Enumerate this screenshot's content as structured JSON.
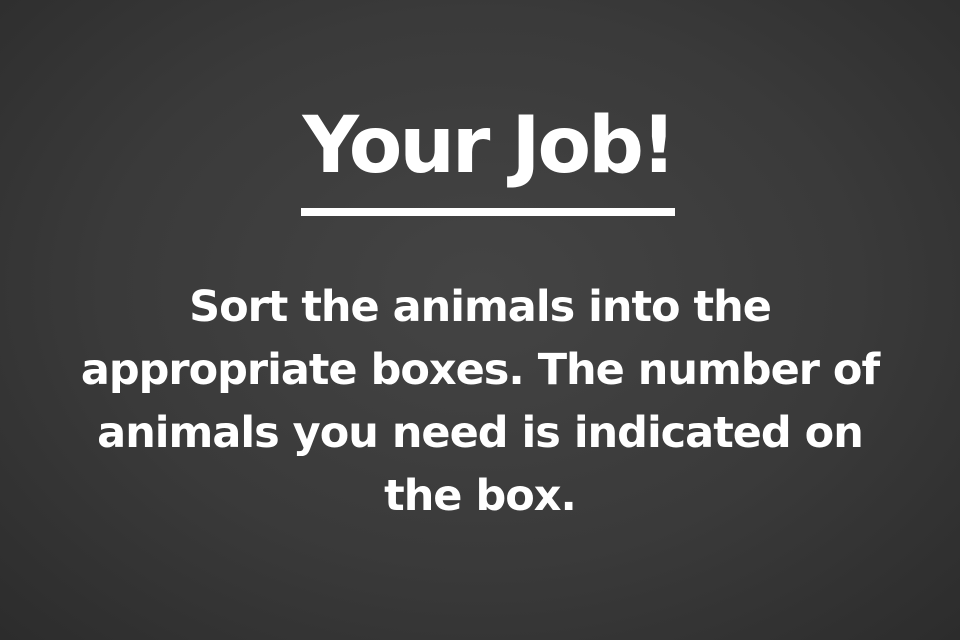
{
  "screen": {
    "title": "Your Job!",
    "instructions": "Sort the animals into the appropriate boxes. The number of animals you need is indicated on the box."
  },
  "colors": {
    "background": "#3a3a3a",
    "text": "#ffffff"
  }
}
